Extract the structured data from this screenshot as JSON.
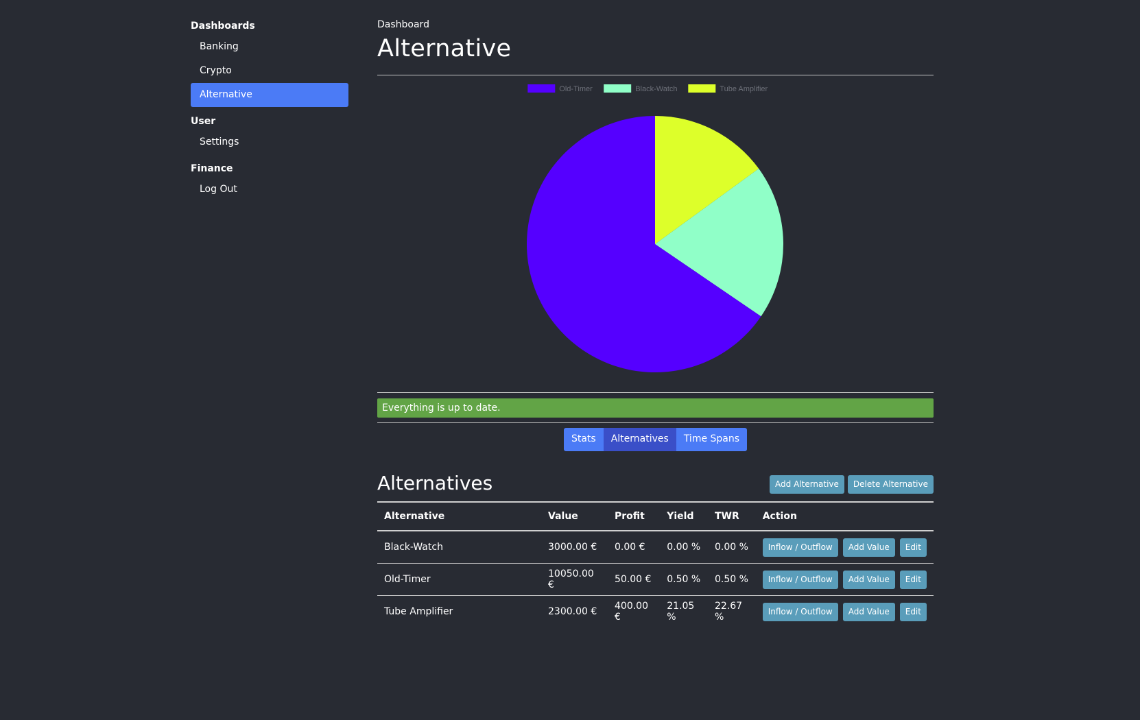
{
  "sidebar": {
    "sections": [
      {
        "heading": "Dashboards",
        "items": [
          {
            "label": "Banking",
            "active": false
          },
          {
            "label": "Crypto",
            "active": false
          },
          {
            "label": "Alternative",
            "active": true
          }
        ]
      },
      {
        "heading": "User",
        "items": [
          {
            "label": "Settings",
            "active": false
          }
        ]
      },
      {
        "heading": "Finance",
        "items": [
          {
            "label": "Log Out",
            "active": false
          }
        ]
      }
    ]
  },
  "header": {
    "breadcrumb": "Dashboard",
    "title": "Alternative"
  },
  "chart_data": {
    "type": "pie",
    "categories": [
      "Old-Timer",
      "Black-Watch",
      "Tube Amplifier"
    ],
    "values": [
      10050,
      3000,
      2300
    ],
    "colors": [
      "#5500ff",
      "#90ffc8",
      "#ddff2a"
    ],
    "legend_position": "top-center"
  },
  "status": {
    "message": "Everything is up to date.",
    "color": "#62a446"
  },
  "tabs": [
    {
      "label": "Stats",
      "active": false
    },
    {
      "label": "Alternatives",
      "active": true
    },
    {
      "label": "Time Spans",
      "active": false
    }
  ],
  "alternatives": {
    "title": "Alternatives",
    "add_label": "Add Alternative",
    "delete_label": "Delete Alternative",
    "columns": [
      "Alternative",
      "Value",
      "Profit",
      "Yield",
      "TWR",
      "Action"
    ],
    "rows": [
      {
        "name": "Black-Watch",
        "value": "3000.00 €",
        "profit": "0.00 €",
        "yield": "0.00 %",
        "twr": "0.00 %"
      },
      {
        "name": "Old-Timer",
        "value": "10050.00 €",
        "profit": "50.00 €",
        "yield": "0.50 %",
        "twr": "0.50 %"
      },
      {
        "name": "Tube Amplifier",
        "value": "2300.00 €",
        "profit": "400.00 €",
        "yield": "21.05 %",
        "twr": "22.67 %"
      }
    ],
    "row_actions": {
      "inflow": "Inflow / Outflow",
      "add_value": "Add Value",
      "edit": "Edit"
    }
  },
  "colors": {
    "background": "#282b33",
    "accent": "#4b7bf6",
    "button": "#5a9dba"
  }
}
